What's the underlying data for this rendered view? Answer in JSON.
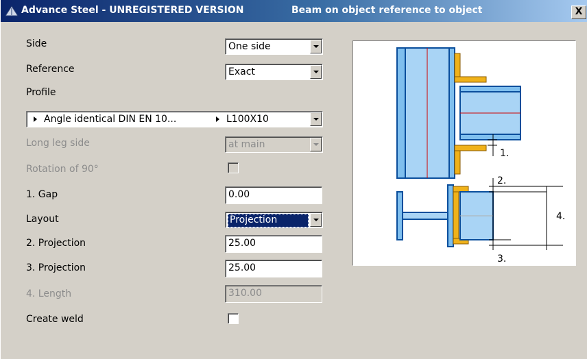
{
  "window": {
    "title": "Advance Steel - UNREGISTERED VERSION",
    "subtitle": "Beam on object reference to object",
    "close_label": "X"
  },
  "form": {
    "side": {
      "label": "Side",
      "value": "One side"
    },
    "reference": {
      "label": "Reference",
      "value": "Exact"
    },
    "profile": {
      "label": "Profile",
      "section": "Angle identical DIN EN 10...",
      "value": "L100X10"
    },
    "long_leg_side": {
      "label": "Long leg side",
      "value": "at main"
    },
    "rotation": {
      "label": "Rotation of 90°",
      "checked": false
    },
    "gap": {
      "label": "1. Gap",
      "value": "0.00"
    },
    "layout": {
      "label": "Layout",
      "value": "Projection"
    },
    "projection2": {
      "label": "2. Projection",
      "value": "25.00"
    },
    "projection3": {
      "label": "3. Projection",
      "value": "25.00"
    },
    "length4": {
      "label": "4. Length",
      "value": "310.00"
    },
    "create_weld": {
      "label": "Create weld",
      "checked": false
    }
  },
  "diagram": {
    "labels": {
      "gap": "1.",
      "proj2": "2.",
      "proj3": "3.",
      "length": "4."
    },
    "colors": {
      "steel_blue": "#7fbfee",
      "steel_edge": "#0a4e9c",
      "angle": "#f0b21a",
      "red_line": "#d00000"
    }
  }
}
